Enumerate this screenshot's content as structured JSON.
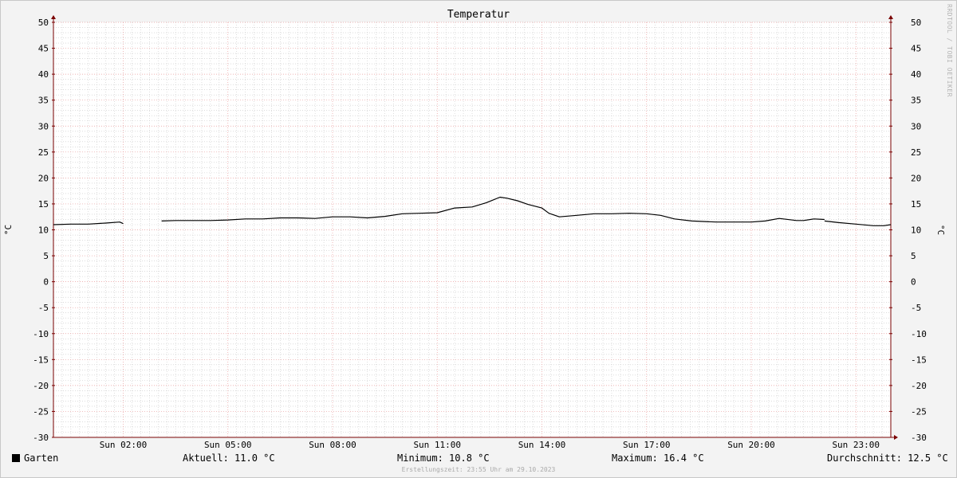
{
  "chart_data": {
    "type": "line",
    "title": "Temperatur",
    "ylabel": "°C",
    "ylim": [
      -30,
      50
    ],
    "yticks": [
      -30,
      -25,
      -20,
      -15,
      -10,
      -5,
      0,
      5,
      10,
      15,
      20,
      25,
      30,
      35,
      40,
      45,
      50
    ],
    "xlim_hours": [
      0,
      24
    ],
    "xticks": [
      {
        "hour": 2,
        "label": "Sun 02:00"
      },
      {
        "hour": 5,
        "label": "Sun 05:00"
      },
      {
        "hour": 8,
        "label": "Sun 08:00"
      },
      {
        "hour": 11,
        "label": "Sun 11:00"
      },
      {
        "hour": 14,
        "label": "Sun 14:00"
      },
      {
        "hour": 17,
        "label": "Sun 17:00"
      },
      {
        "hour": 20,
        "label": "Sun 20:00"
      },
      {
        "hour": 23,
        "label": "Sun 23:00"
      }
    ],
    "grid": true,
    "series": [
      {
        "name": "Garten",
        "color": "#000000",
        "segments": [
          [
            [
              0,
              11.0
            ],
            [
              0.5,
              11.1
            ],
            [
              1.0,
              11.1
            ],
            [
              1.5,
              11.3
            ],
            [
              1.9,
              11.5
            ],
            [
              2.0,
              11.2
            ]
          ],
          [
            [
              3.1,
              11.7
            ],
            [
              3.5,
              11.8
            ],
            [
              4.0,
              11.8
            ],
            [
              4.5,
              11.8
            ],
            [
              5.0,
              11.9
            ],
            [
              5.5,
              12.1
            ],
            [
              6.0,
              12.1
            ],
            [
              6.5,
              12.3
            ],
            [
              7.0,
              12.3
            ],
            [
              7.5,
              12.2
            ],
            [
              8.0,
              12.5
            ],
            [
              8.5,
              12.5
            ],
            [
              9.0,
              12.3
            ],
            [
              9.5,
              12.6
            ],
            [
              10.0,
              13.1
            ],
            [
              10.5,
              13.2
            ],
            [
              11.0,
              13.3
            ],
            [
              11.5,
              14.2
            ],
            [
              12.0,
              14.4
            ],
            [
              12.4,
              15.2
            ],
            [
              12.8,
              16.3
            ],
            [
              13.0,
              16.1
            ],
            [
              13.3,
              15.6
            ],
            [
              13.6,
              14.9
            ],
            [
              14.0,
              14.2
            ],
            [
              14.2,
              13.2
            ],
            [
              14.5,
              12.5
            ],
            [
              15.0,
              12.8
            ],
            [
              15.5,
              13.1
            ],
            [
              16.0,
              13.1
            ],
            [
              16.5,
              13.2
            ],
            [
              17.0,
              13.1
            ],
            [
              17.4,
              12.8
            ],
            [
              17.8,
              12.1
            ],
            [
              18.3,
              11.7
            ],
            [
              19.0,
              11.5
            ],
            [
              19.5,
              11.5
            ],
            [
              20.0,
              11.5
            ],
            [
              20.4,
              11.7
            ],
            [
              20.8,
              12.2
            ],
            [
              21.3,
              11.8
            ],
            [
              21.5,
              11.8
            ],
            [
              21.8,
              12.1
            ],
            [
              22.1,
              12.0
            ]
          ],
          [
            [
              22.1,
              11.7
            ],
            [
              22.5,
              11.4
            ],
            [
              23.0,
              11.1
            ],
            [
              23.5,
              10.8
            ],
            [
              23.8,
              10.8
            ],
            [
              24.0,
              11.0
            ]
          ]
        ]
      }
    ]
  },
  "legend": {
    "series_name": "Garten",
    "aktuell": "Aktuell: 11.0 °C",
    "minimum": "Minimum: 10.8 °C",
    "maximum": "Maximum: 16.4 °C",
    "durchschnitt": "Durchschnitt: 12.5 °C"
  },
  "footer": "Erstellungszeit: 23:55 Uhr am 29.10.2023",
  "watermark": "RRDTOOL / TOBI OETIKER",
  "colors": {
    "major_grid": "#e89a9a",
    "minor_grid": "#c8c8c8",
    "axis": "#7a0000"
  }
}
